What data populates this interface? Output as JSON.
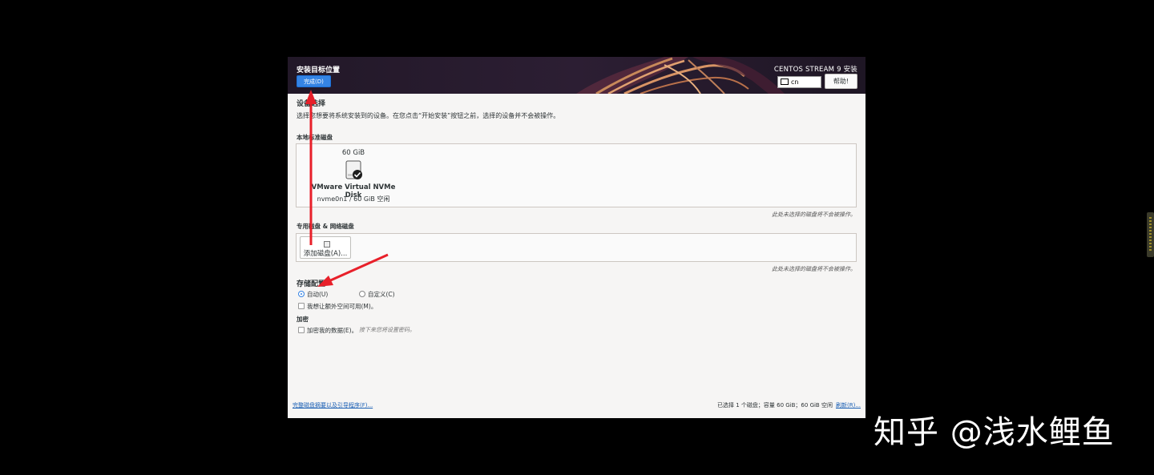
{
  "header": {
    "title": "安装目标位置",
    "done_label": "完成(D)",
    "product": "CENTOS STREAM 9 安装",
    "keyboard_layout": "cn",
    "help_label": "帮助!"
  },
  "device_selection": {
    "title": "设备选择",
    "description": "选择您想要将系统安装到的设备。在您点击“开始安装”按钮之前，选择的设备并不会被操作。"
  },
  "local_disks": {
    "label": "本地标准磁盘",
    "disk": {
      "size": "60 GiB",
      "name": "VMware Virtual NVMe Disk",
      "detail": "nvme0n1  /  60 GiB 空闲",
      "selected": true
    },
    "note": "此处未选择的磁盘将不会被操作。"
  },
  "specialized_disks": {
    "label": "专用磁盘 & 网络磁盘",
    "add_label": "添加磁盘(A)...",
    "note": "此处未选择的磁盘将不会被操作。"
  },
  "storage_config": {
    "title": "存储配置",
    "auto_label": "自动(U)",
    "custom_label": "自定义(C)",
    "auto_selected": true,
    "extra_space_label": "我想让额外空间可用(M)。"
  },
  "encryption": {
    "title": "加密",
    "encrypt_label": "加密我的数据(E)。",
    "hint": "接下来您将设置密码。"
  },
  "footer": {
    "summary_link": "完整磁盘摘要以及引导程序(F)...",
    "status": "已选择 1 个磁盘；容量 60 GiB；60 GiB 空闲",
    "refresh_link": "刷新(R)..."
  },
  "watermark": "知乎 @浅水鲤鱼",
  "colors": {
    "accent": "#3584e4",
    "annotation_arrow": "#e8202a",
    "header_bg": "#241a2a"
  }
}
